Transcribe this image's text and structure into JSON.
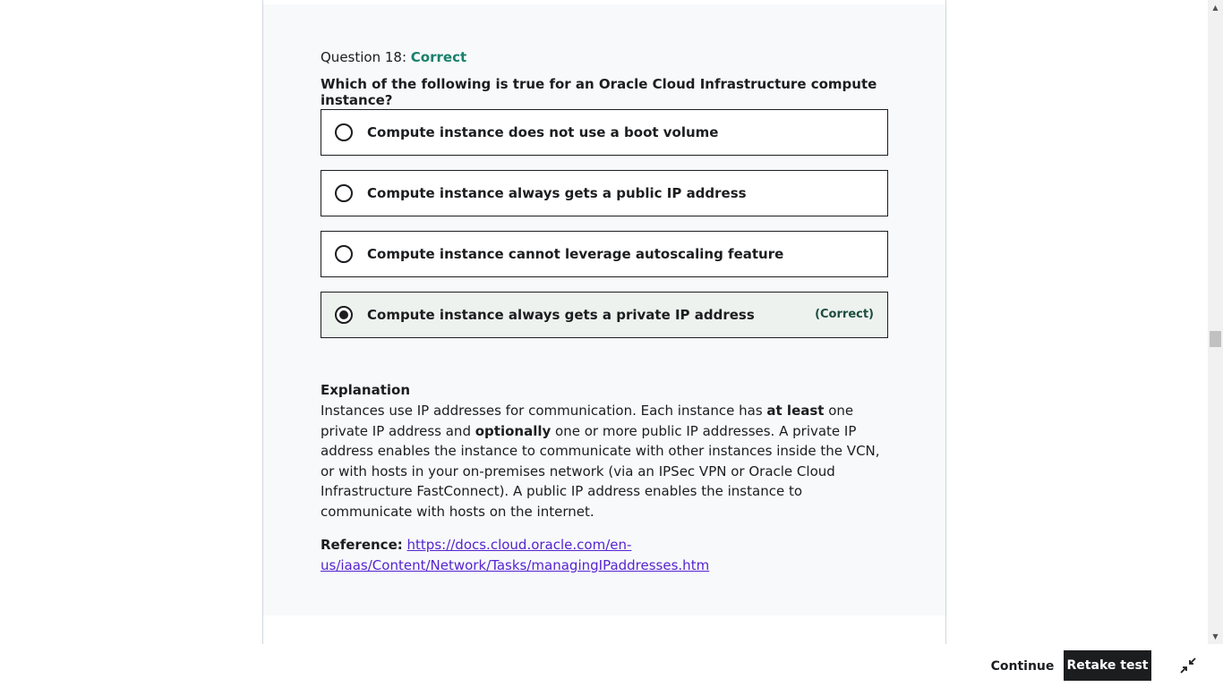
{
  "question": {
    "header_prefix": "Question 18:",
    "status": "Correct",
    "text": "Which of the following is true for an Oracle Cloud Infrastructure compute instance?"
  },
  "options": [
    {
      "label": "Compute instance does not use a boot volume",
      "selected": false
    },
    {
      "label": "Compute instance always gets a public IP address",
      "selected": false
    },
    {
      "label": "Compute instance cannot leverage autoscaling feature",
      "selected": false
    },
    {
      "label": "Compute instance always gets a private IP address",
      "selected": true,
      "tag": "(Correct)"
    }
  ],
  "explanation": {
    "title": "Explanation",
    "part1": "Instances use IP addresses for communication. Each instance has ",
    "bold1": "at least",
    "part2": " one private IP address and ",
    "bold2": "optionally",
    "part3": " one or more public IP addresses. A private IP address enables the instance to communicate with other instances inside the VCN, or with hosts in your on-premises network (via an IPSec VPN or Oracle Cloud Infrastructure FastConnect). A public IP address enables the instance to communicate with hosts on the internet."
  },
  "reference": {
    "label": "Reference:",
    "url": "https://docs.cloud.oracle.com/en-us/iaas/Content/Network/Tasks/managingIPaddresses.htm"
  },
  "footer": {
    "continue_label": "Continue",
    "retake_label": "Retake test",
    "collapse_icon": "collapse-icon"
  },
  "colors": {
    "correct_green": "#19806b",
    "link_purple": "#5624d0",
    "dark": "#1c1d1f"
  }
}
